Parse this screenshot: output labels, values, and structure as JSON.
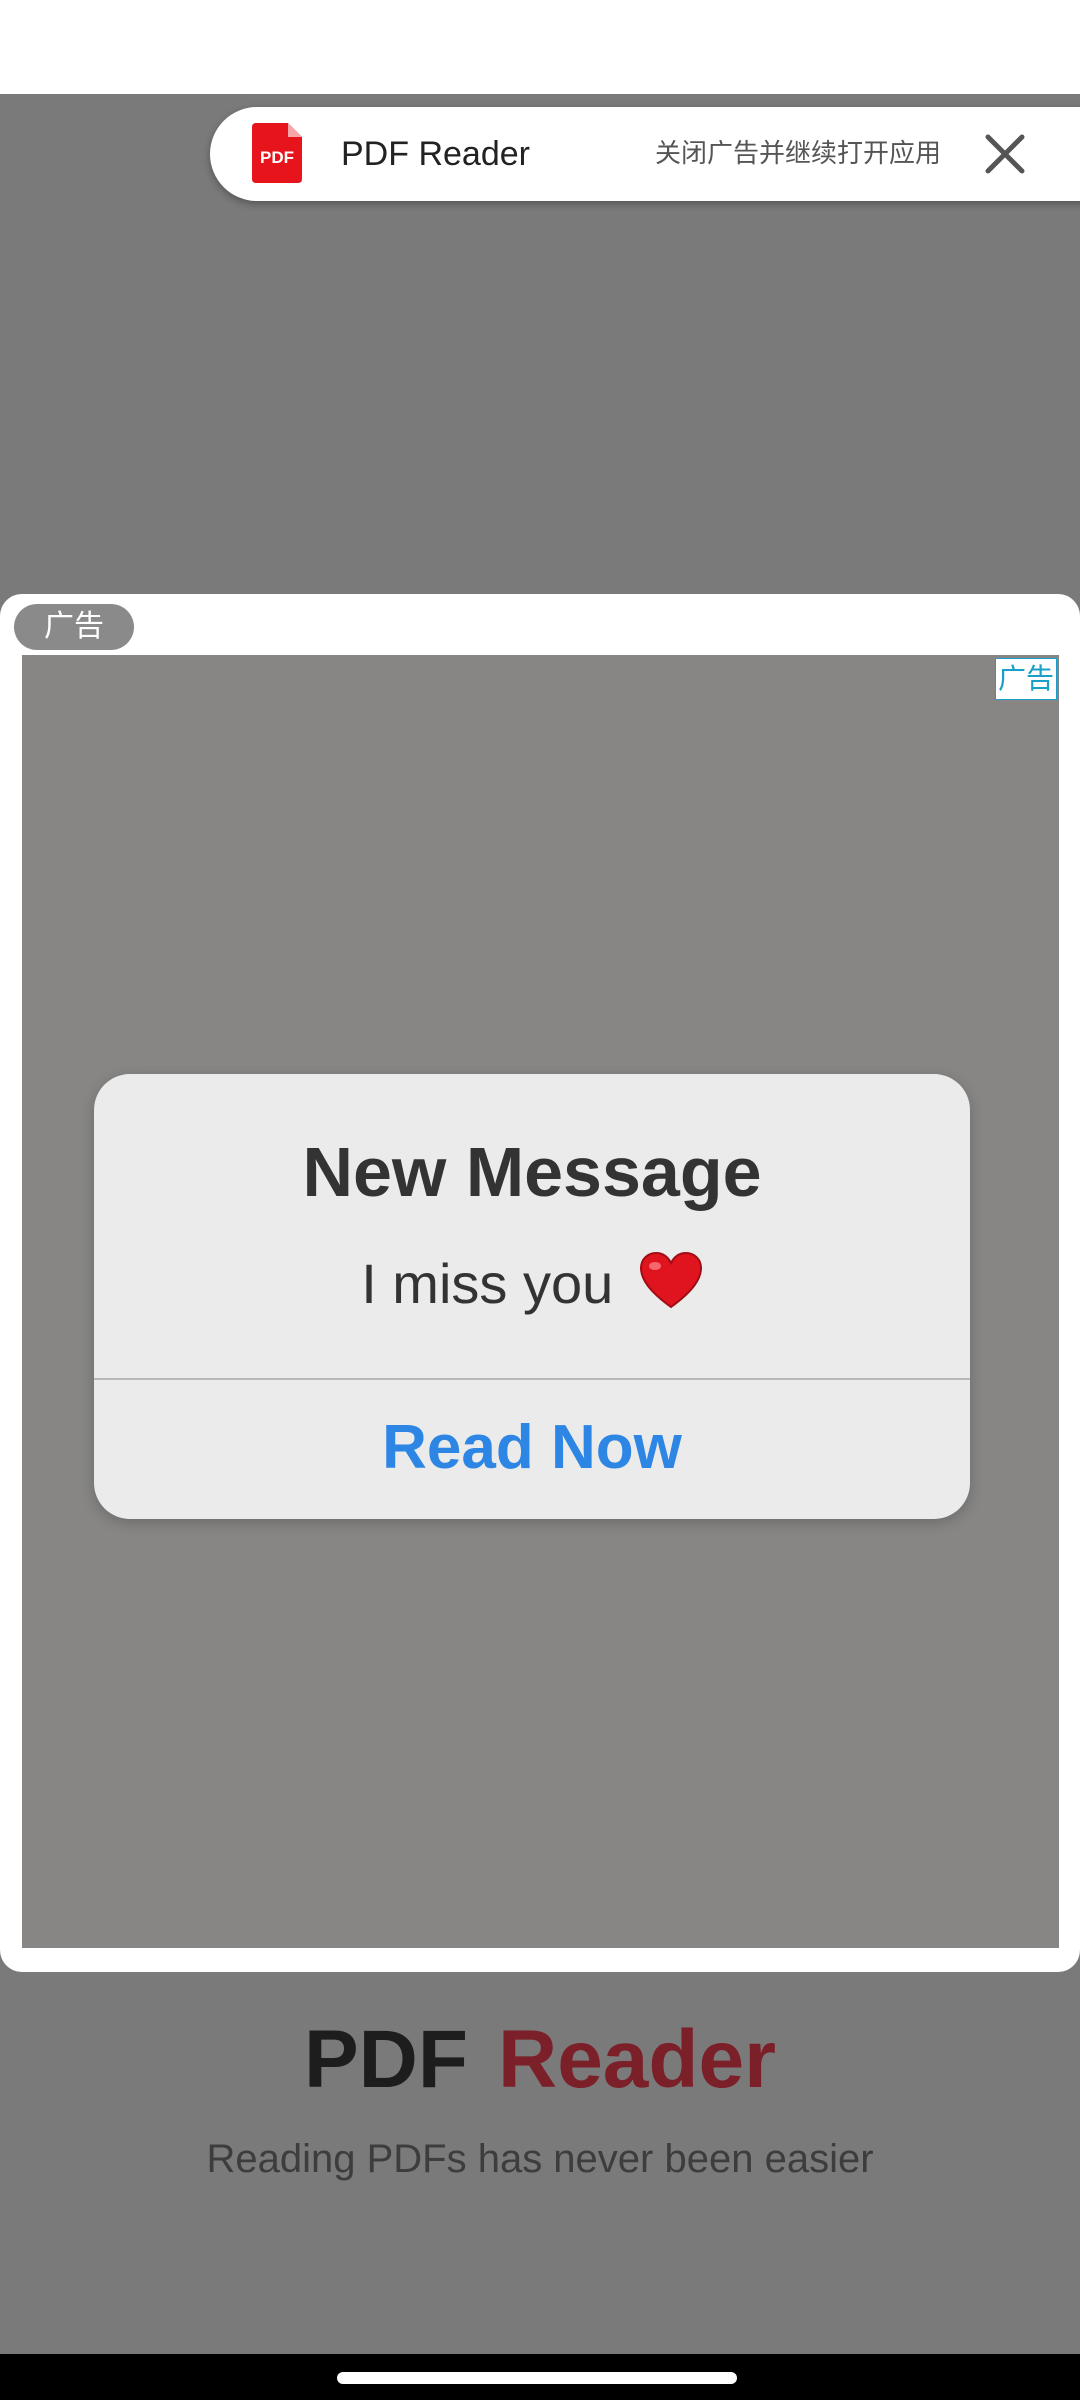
{
  "ad_close_bar": {
    "app_icon": "pdf-app-icon",
    "app_icon_text": "PDF",
    "app_name": "PDF Reader",
    "close_hint": "关闭广告并继续打开应用",
    "close_icon": "close-icon"
  },
  "ad": {
    "badge": "广告",
    "adchoice": "广告",
    "dialog": {
      "title": "New Message",
      "message": "I miss you",
      "message_emoji": "heart-icon",
      "action": "Read Now"
    }
  },
  "brand": {
    "word1": "PDF",
    "word2": "Reader",
    "tagline": "Reading PDFs has never been easier"
  },
  "colors": {
    "action_blue": "#2e86e4",
    "brand_red": "#7b1f28",
    "pdf_icon_red": "#e8141c",
    "overlay_gray": "#7a7a7a"
  }
}
